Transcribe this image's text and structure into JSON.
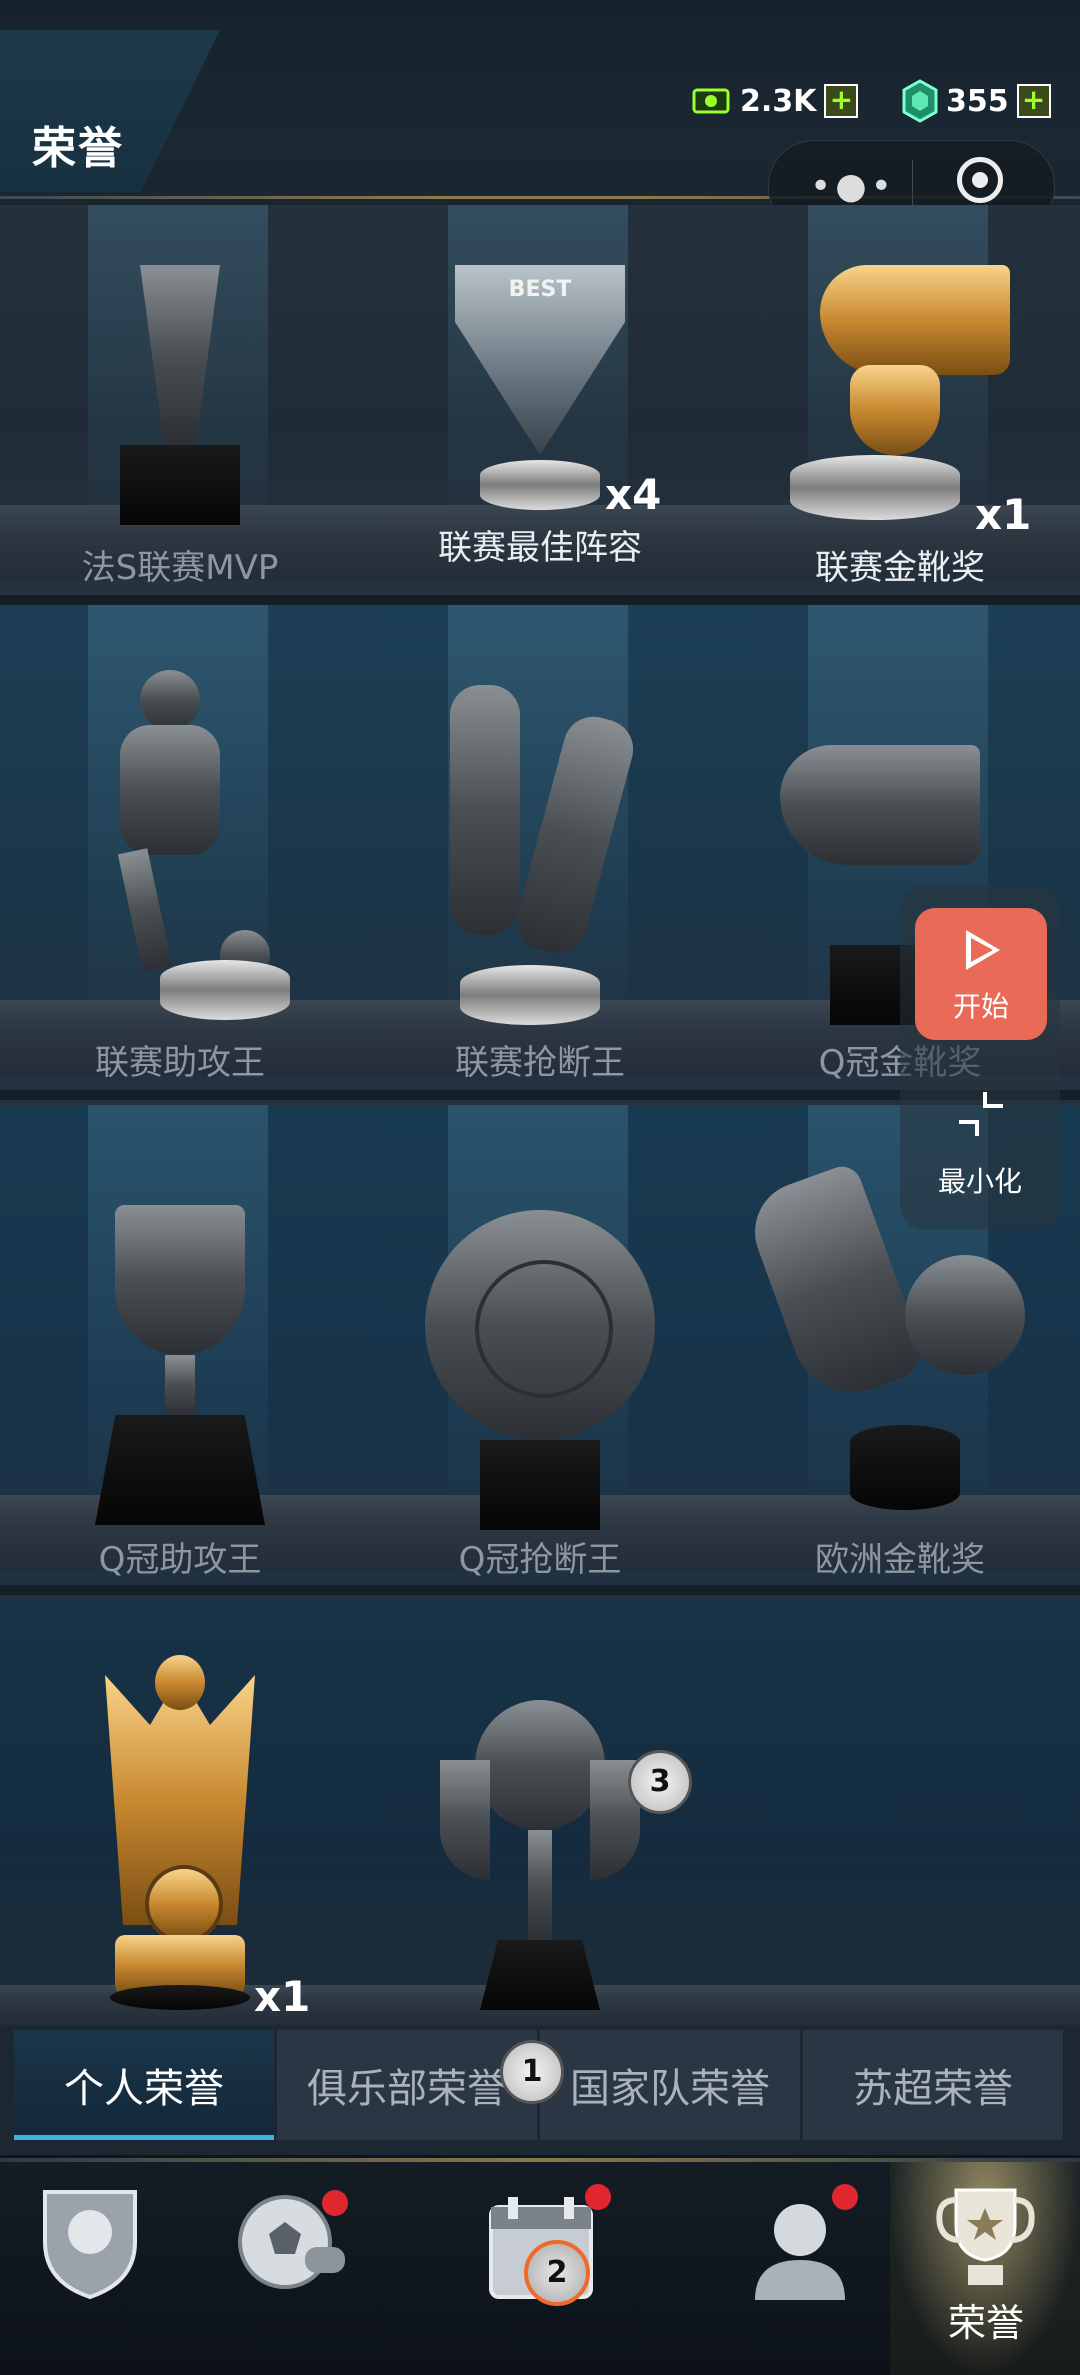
{
  "header": {
    "title": "荣誉",
    "coins": "2.3K",
    "gems": "355",
    "plus_symbol": "+"
  },
  "shelves": [
    {
      "trophies": [
        {
          "label": "法S联赛MVP",
          "count": "",
          "lit": false
        },
        {
          "label": "联赛最佳阵容",
          "count": "x4",
          "lit": true,
          "engraving": "BEST"
        },
        {
          "label": "联赛金靴奖",
          "count": "x1",
          "lit": true
        }
      ]
    },
    {
      "trophies": [
        {
          "label": "联赛助攻王",
          "count": "",
          "lit": false
        },
        {
          "label": "联赛抢断王",
          "count": "",
          "lit": false
        },
        {
          "label": "Q冠金靴奖",
          "count": "",
          "lit": false
        }
      ]
    },
    {
      "trophies": [
        {
          "label": "Q冠助攻王",
          "count": "",
          "lit": false
        },
        {
          "label": "Q冠抢断王",
          "count": "",
          "lit": false
        },
        {
          "label": "欧洲金靴奖",
          "count": "",
          "lit": false
        }
      ]
    },
    {
      "trophies": [
        {
          "label": "",
          "count": "x1",
          "lit": true
        },
        {
          "label": "",
          "count": "",
          "lit": false
        }
      ]
    }
  ],
  "tabs": [
    {
      "label": "个人荣誉",
      "active": true
    },
    {
      "label": "俱乐部荣誉",
      "active": false
    },
    {
      "label": "国家队荣誉",
      "active": false
    },
    {
      "label": "苏超荣誉",
      "active": false
    }
  ],
  "floating": {
    "start_label": "开始",
    "minimize_label": "最小化"
  },
  "markers": {
    "m1": "1",
    "m2": "2",
    "m3": "3"
  },
  "bottom_nav": {
    "active_label": "荣誉",
    "items": [
      "team-badge-icon",
      "ball-whistle-icon",
      "calendar-icon",
      "player-icon",
      "trophy-icon"
    ]
  },
  "colors": {
    "accent_tab": "#3db4e0",
    "start_button": "#e86a57",
    "currency_green": "#9cff2e",
    "gold": "#c88930"
  }
}
